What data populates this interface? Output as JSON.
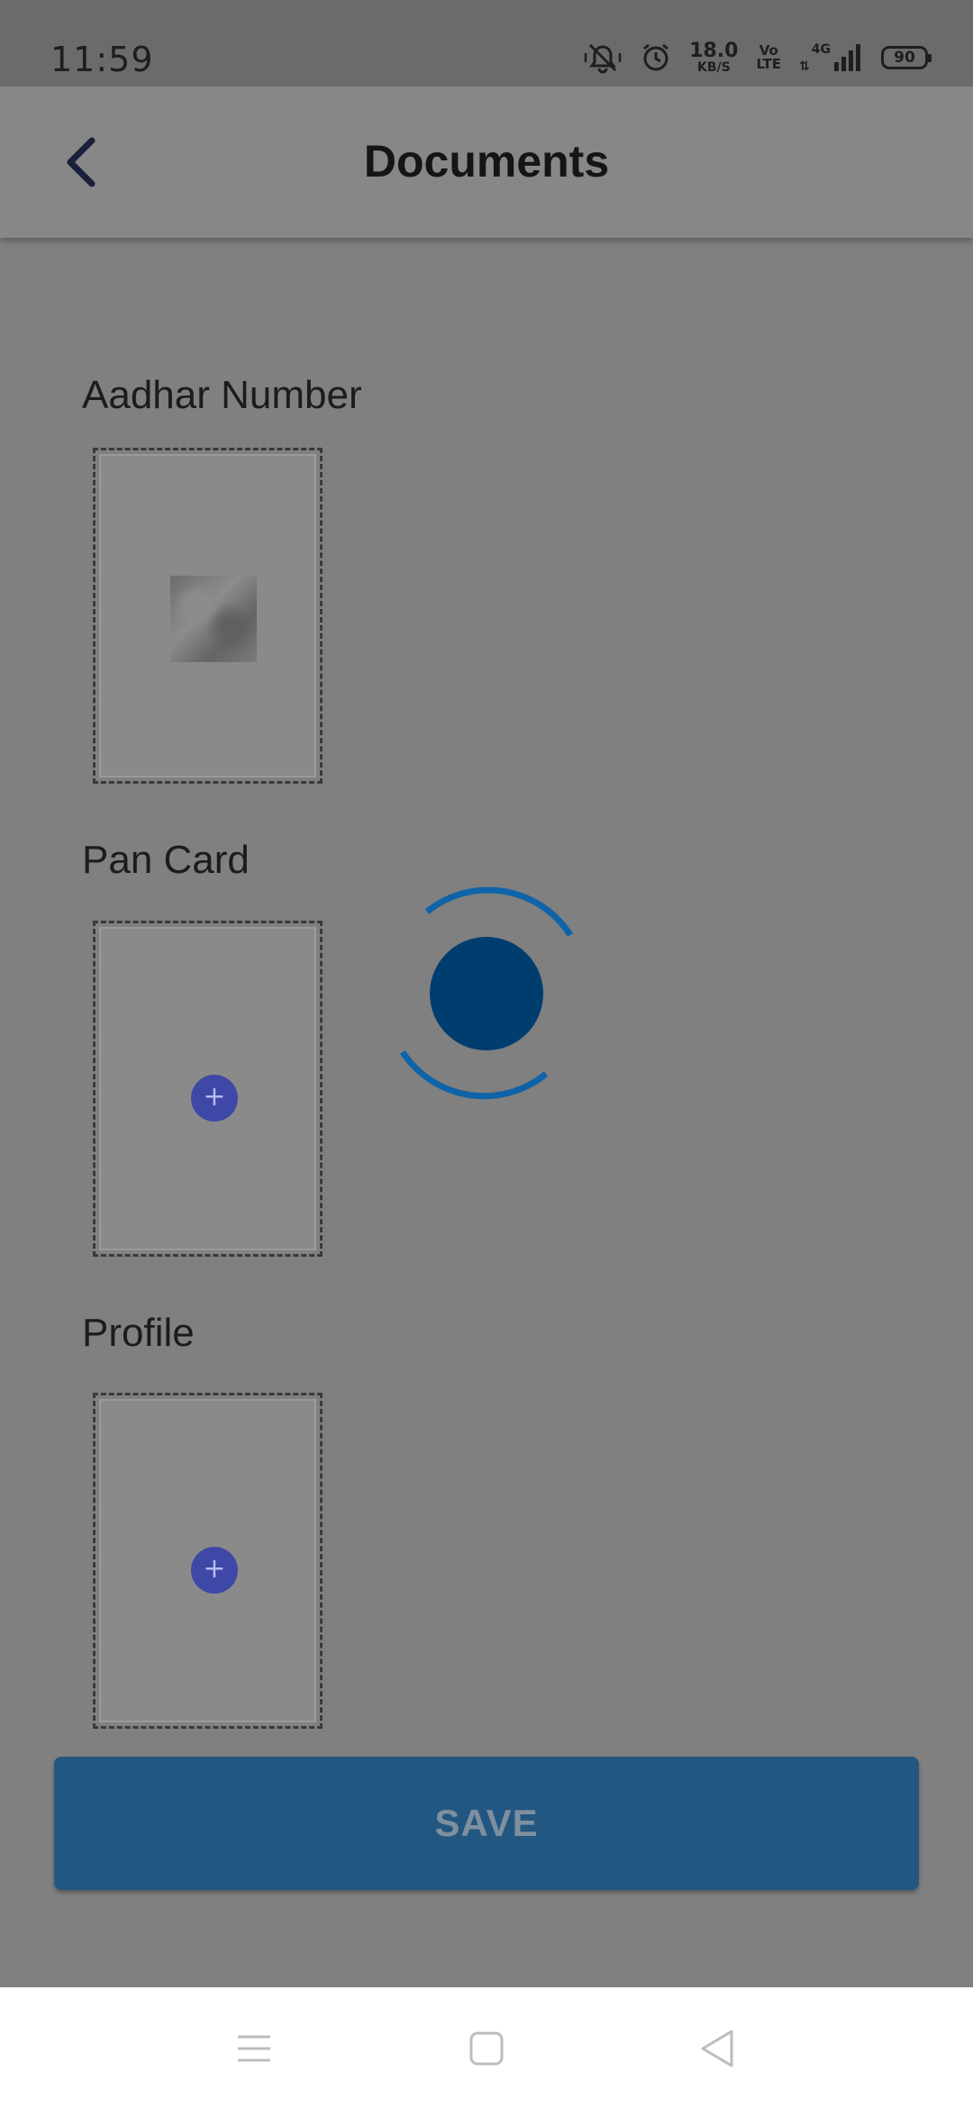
{
  "status_bar": {
    "time": "11:59",
    "net_speed_value": "18.0",
    "net_speed_unit": "KB/S",
    "volte_top": "Vo",
    "volte_bottom": "LTE",
    "network_type": "4G",
    "battery_level": "90",
    "icons": [
      "vibrate-mute-icon",
      "alarm-icon",
      "volte-icon",
      "data-arrows-icon",
      "signal-bars-icon",
      "battery-icon"
    ]
  },
  "app_bar": {
    "title": "Documents",
    "back_icon": "chevron-left-icon"
  },
  "documents": [
    {
      "label": "Aadhar Number",
      "state": "uploaded",
      "icon": "image-thumbnail"
    },
    {
      "label": "Pan Card",
      "state": "empty",
      "add_symbol": "+",
      "icon": "plus-icon"
    },
    {
      "label": "Profile",
      "state": "empty",
      "add_symbol": "+",
      "icon": "plus-icon"
    }
  ],
  "loading": {
    "icon": "loading-spinner-icon"
  },
  "actions": {
    "save_label": "SAVE"
  },
  "nav_bar": {
    "icons": [
      "menu-icon",
      "home-icon",
      "back-triangle-icon"
    ]
  },
  "colors": {
    "overlay_background": "#808080",
    "primary_button": "#225782",
    "spinner_fill": "#003d6f",
    "spinner_ring": "#0f63a8",
    "add_button": "#3f48a6"
  }
}
